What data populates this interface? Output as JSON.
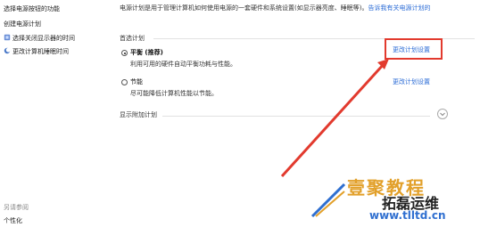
{
  "sidebar": {
    "items": [
      {
        "label": "选择电源按钮的功能"
      },
      {
        "label": "创建电源计划"
      },
      {
        "label": "选择关闭显示器的时间"
      },
      {
        "label": "更改计算机睡眠时间"
      }
    ],
    "see_also_heading": "另请参阅",
    "see_also_items": [
      {
        "label": "个性化"
      }
    ]
  },
  "main": {
    "description": "电源计划是用于管理计算机如何使用电源的一套硬件和系统设置(如显示器亮度、睡眠等)。",
    "description_link": "告诉我有关电源计划的",
    "preferred_heading": "首选计划",
    "plans": [
      {
        "name": "平衡 (推荐)",
        "description": "利用可用的硬件自动平衡功耗与性能。",
        "action": "更改计划设置",
        "selected": true
      },
      {
        "name": "节能",
        "description": "尽可能降低计算机性能以节能。",
        "action": "更改计划设置",
        "selected": false
      }
    ],
    "show_more": "显示附加计划"
  },
  "annotation": {
    "highlight_color": "#e23a2e"
  },
  "watermark": {
    "line1": "壹聚教程",
    "line2": "拓磊运维",
    "url": "www.tlltd.cn"
  }
}
